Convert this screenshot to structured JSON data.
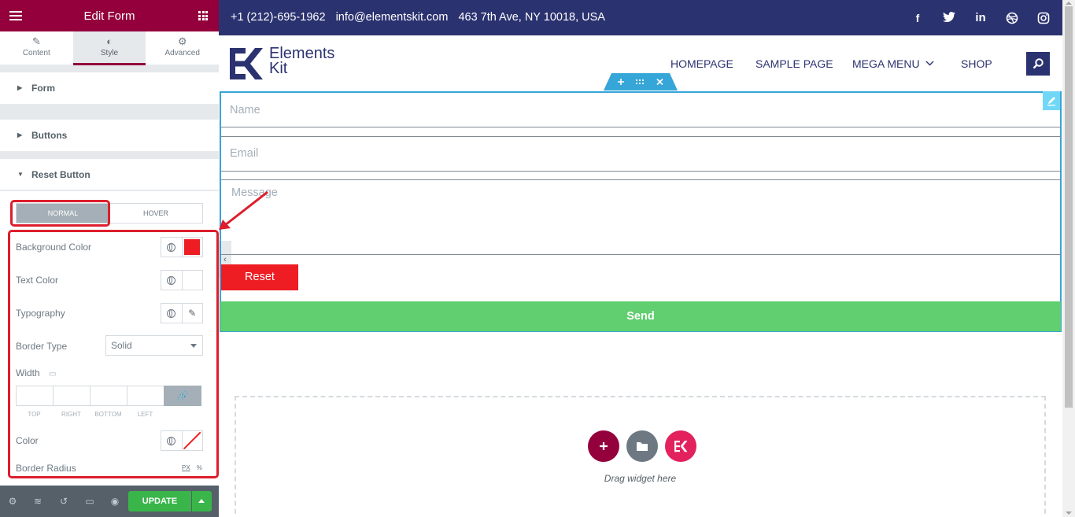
{
  "panel": {
    "title": "Edit Form",
    "tabs": [
      {
        "label": "Content",
        "icon": "pencil-icon"
      },
      {
        "label": "Style",
        "icon": "half-circle-icon"
      },
      {
        "label": "Advanced",
        "icon": "gear-icon"
      }
    ],
    "sections": {
      "form": "Form",
      "buttons": "Buttons",
      "reset": "Reset Button"
    },
    "states": {
      "normal": "NORMAL",
      "hover": "HOVER"
    },
    "controls": {
      "background_color": "Background Color",
      "background_color_value": "#ee1d23",
      "text_color": "Text Color",
      "typography": "Typography",
      "border_type": "Border Type",
      "border_type_value": "Solid",
      "width": "Width",
      "dim_labels": [
        "TOP",
        "RIGHT",
        "BOTTOM",
        "LEFT"
      ],
      "color": "Color",
      "border_radius": "Border Radius",
      "unit_px": "PX",
      "unit_pct": "%"
    },
    "footer": {
      "update": "UPDATE"
    }
  },
  "site": {
    "phone": "+1 (212)-695-1962",
    "email": "info@elementskit.com",
    "address": "463 7th Ave, NY 10018, USA",
    "social": [
      "facebook-icon",
      "twitter-icon",
      "linkedin-icon",
      "dribbble-icon",
      "instagram-icon"
    ],
    "logo_line1": "Elements",
    "logo_line2": "Kit",
    "nav": [
      "HOMEPAGE",
      "SAMPLE PAGE",
      "MEGA MENU",
      "SHOP"
    ]
  },
  "form": {
    "name_placeholder": "Name",
    "email_placeholder": "Email",
    "message_placeholder": "Message",
    "reset_label": "Reset",
    "send_label": "Send"
  },
  "dropzone": {
    "text": "Drag widget here"
  },
  "colors": {
    "panel_accent": "#93003c",
    "topbar": "#2b3270",
    "reset_button": "#ee1d23",
    "send_button": "#61ce70",
    "update_button": "#39b54a",
    "highlight": "#dd1e2c"
  }
}
